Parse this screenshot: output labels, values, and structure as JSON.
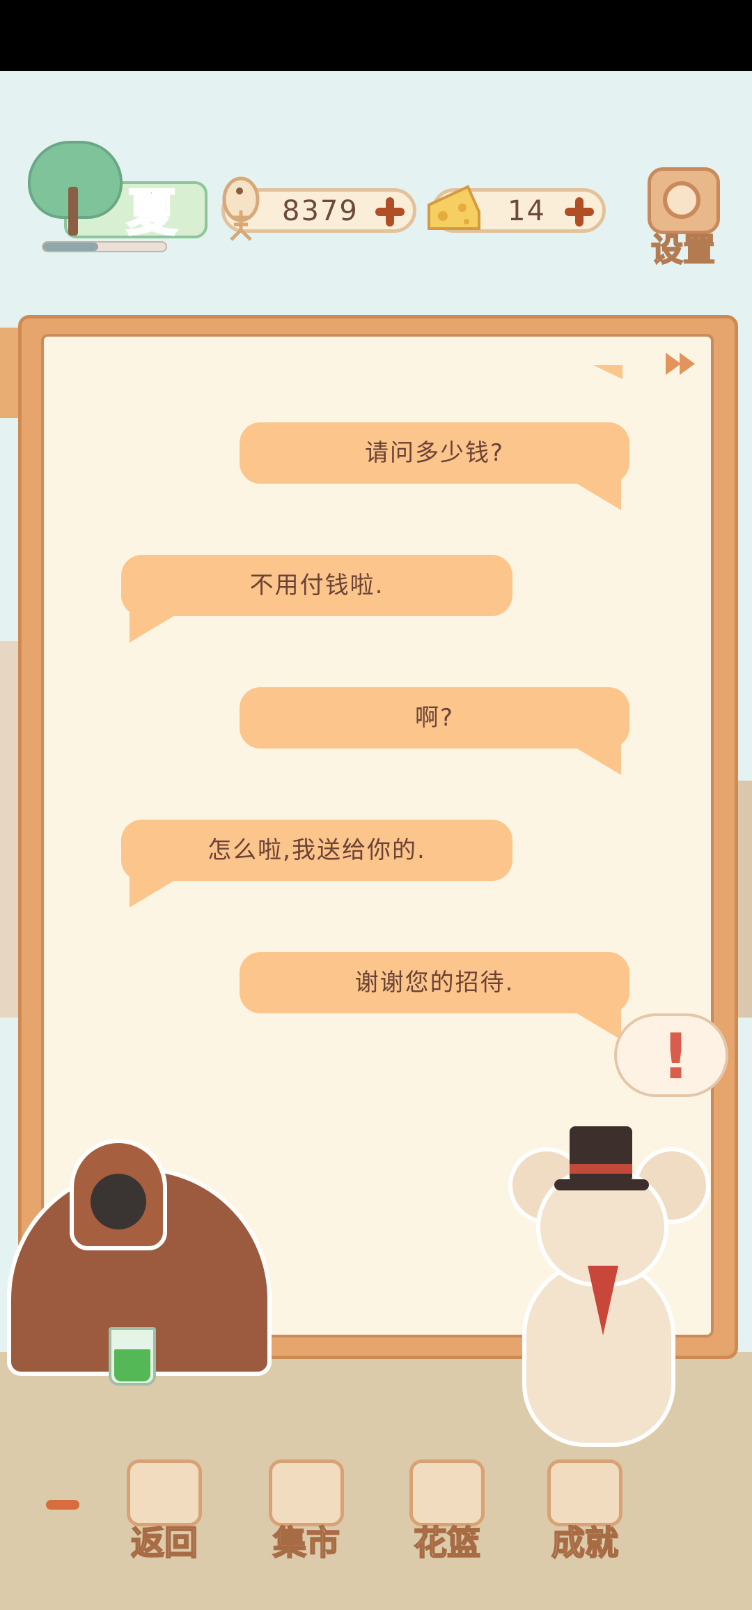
{
  "season": {
    "label": "夏",
    "progress": 0.45
  },
  "currency": {
    "fish": "8379",
    "cheese": "14"
  },
  "settings_label": "设置",
  "dialog": [
    {
      "speaker": "right",
      "text": "请问多少钱?"
    },
    {
      "speaker": "left",
      "text": "不用付钱啦."
    },
    {
      "speaker": "right",
      "text": "啊?"
    },
    {
      "speaker": "left",
      "text": "怎么啦,我送给你的."
    },
    {
      "speaker": "right",
      "text": "谢谢您的招待."
    }
  ],
  "exclaim": "!",
  "nav": [
    {
      "label": "返回",
      "icon": "window-icon"
    },
    {
      "label": "集市",
      "icon": "market-stall-icon"
    },
    {
      "label": "花篮",
      "icon": "flower-basket-icon"
    },
    {
      "label": "成就",
      "icon": "trophy-icon"
    }
  ],
  "colors": {
    "bubble": "#fcc58b",
    "panel": "#e6a56c",
    "panel_inner": "#fdf5e3",
    "accent": "#b24e26"
  }
}
